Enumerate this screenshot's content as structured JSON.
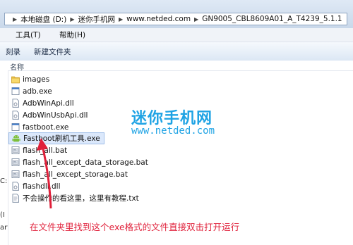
{
  "address_bar": {
    "crumbs": [
      "本地磁盘 (D:)",
      "迷你手机网",
      "www.netded.com",
      "GN9005_CBL8609A01_A_T4239_5.1.1"
    ]
  },
  "menu": {
    "tools_label": "工具(T)",
    "help_label": "帮助(H)"
  },
  "toolbar": {
    "burn_label": "刻录",
    "new_folder_label": "新建文件夹"
  },
  "columns": {
    "name_label": "名称"
  },
  "nav_fragments": [
    "C:",
    "(I",
    "ary"
  ],
  "files": [
    {
      "name": "images",
      "icon": "folder-icon"
    },
    {
      "name": "adb.exe",
      "icon": "exe-icon"
    },
    {
      "name": "AdbWinApi.dll",
      "icon": "dll-icon"
    },
    {
      "name": "AdbWinUsbApi.dll",
      "icon": "dll-icon"
    },
    {
      "name": "fastboot.exe",
      "icon": "exe-icon"
    },
    {
      "name": "Fastboot刷机工具.exe",
      "icon": "android-icon"
    },
    {
      "name": "flash_all.bat",
      "icon": "bat-icon"
    },
    {
      "name": "flash_all_except_data_storage.bat",
      "icon": "bat-icon"
    },
    {
      "name": "flash_all_except_storage.bat",
      "icon": "bat-icon"
    },
    {
      "name": "flashdll.dll",
      "icon": "dll-icon"
    },
    {
      "name": "不会操作的看这里，这里有教程.txt",
      "icon": "txt-icon"
    }
  ],
  "watermark": {
    "title": "迷你手机网",
    "url": "www.netded.com"
  },
  "annotation": {
    "text": "在文件夹里找到这个exe格式的文件直接双击打开运行"
  },
  "colors": {
    "accent": "#1fa3e4",
    "annotation": "#e0203a",
    "selection": "#dbe8fb"
  }
}
